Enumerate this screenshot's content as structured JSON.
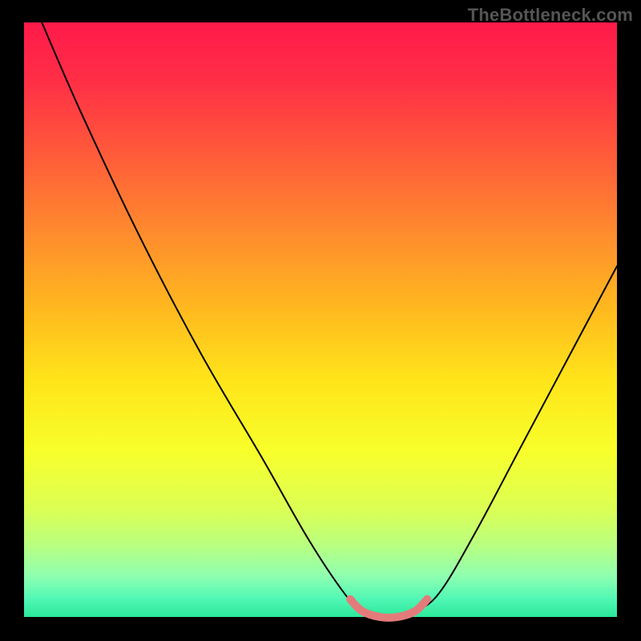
{
  "watermark": "TheBottleneck.com",
  "chart_data": {
    "type": "line",
    "title": "",
    "xlabel": "",
    "ylabel": "",
    "xlim": [
      0,
      100
    ],
    "ylim": [
      0,
      100
    ],
    "grid": false,
    "legend": false,
    "background_gradient_stops": [
      {
        "offset": 0.0,
        "color": "#ff1a4a"
      },
      {
        "offset": 0.1,
        "color": "#ff2f46"
      },
      {
        "offset": 0.22,
        "color": "#ff5a3a"
      },
      {
        "offset": 0.35,
        "color": "#ff8a2e"
      },
      {
        "offset": 0.48,
        "color": "#ffb81f"
      },
      {
        "offset": 0.6,
        "color": "#ffe41a"
      },
      {
        "offset": 0.72,
        "color": "#f8ff2a"
      },
      {
        "offset": 0.82,
        "color": "#dbff55"
      },
      {
        "offset": 0.88,
        "color": "#b8ff80"
      },
      {
        "offset": 0.93,
        "color": "#90ffb0"
      },
      {
        "offset": 0.97,
        "color": "#50f7b4"
      },
      {
        "offset": 1.0,
        "color": "#2ce89a"
      }
    ],
    "series": [
      {
        "name": "bottleneck-curve",
        "color": "#000000",
        "stroke_width": 2,
        "points": [
          {
            "x": 3,
            "y": 100
          },
          {
            "x": 10,
            "y": 84
          },
          {
            "x": 20,
            "y": 63
          },
          {
            "x": 30,
            "y": 44
          },
          {
            "x": 40,
            "y": 27
          },
          {
            "x": 48,
            "y": 13
          },
          {
            "x": 54,
            "y": 4
          },
          {
            "x": 57,
            "y": 1
          },
          {
            "x": 60,
            "y": 0
          },
          {
            "x": 63,
            "y": 0
          },
          {
            "x": 66,
            "y": 1
          },
          {
            "x": 70,
            "y": 4
          },
          {
            "x": 76,
            "y": 14
          },
          {
            "x": 84,
            "y": 29
          },
          {
            "x": 92,
            "y": 44
          },
          {
            "x": 100,
            "y": 59
          }
        ]
      },
      {
        "name": "optimal-zone-highlight",
        "color": "#e47b7b",
        "stroke_width": 10,
        "points": [
          {
            "x": 55,
            "y": 3
          },
          {
            "x": 57,
            "y": 1
          },
          {
            "x": 60,
            "y": 0
          },
          {
            "x": 63,
            "y": 0
          },
          {
            "x": 66,
            "y": 1
          },
          {
            "x": 68,
            "y": 3
          }
        ]
      }
    ]
  }
}
